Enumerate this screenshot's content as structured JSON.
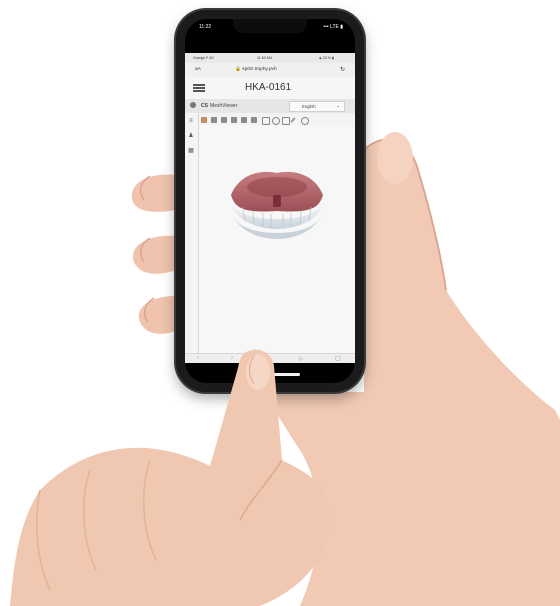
{
  "status_bar": {
    "time": "11:22",
    "indicators": "••• LTE ▮"
  },
  "safari_status": {
    "carrier": "Orange F  4G",
    "time": "11:50 AM",
    "battery": "◈ 23 % ▮"
  },
  "url_bar": {
    "text_size": "aA",
    "url": "🔒 sp0S.trophy.pvh",
    "reload_icon": "reload-icon"
  },
  "app_header": {
    "title": "HKA-0161",
    "menu_icon": "hamburger-menu-icon"
  },
  "viewer_bar": {
    "logo": "CS",
    "name": "MeshViewer",
    "language": "English"
  },
  "side_tools": [
    "layers-icon",
    "person-icon",
    "grid-icon"
  ],
  "toolbar_tools": [
    "view-front-icon",
    "view-back-icon",
    "view-left-icon",
    "view-right-icon",
    "view-top-icon",
    "view-bottom-icon",
    "zoom-icon",
    "measure-icon",
    "section-icon",
    "pen-icon",
    "reset-icon"
  ],
  "colors": {
    "screen_bg": "#f3f3f3",
    "gum": "#b86a6e",
    "teeth": "#eef2f5"
  }
}
